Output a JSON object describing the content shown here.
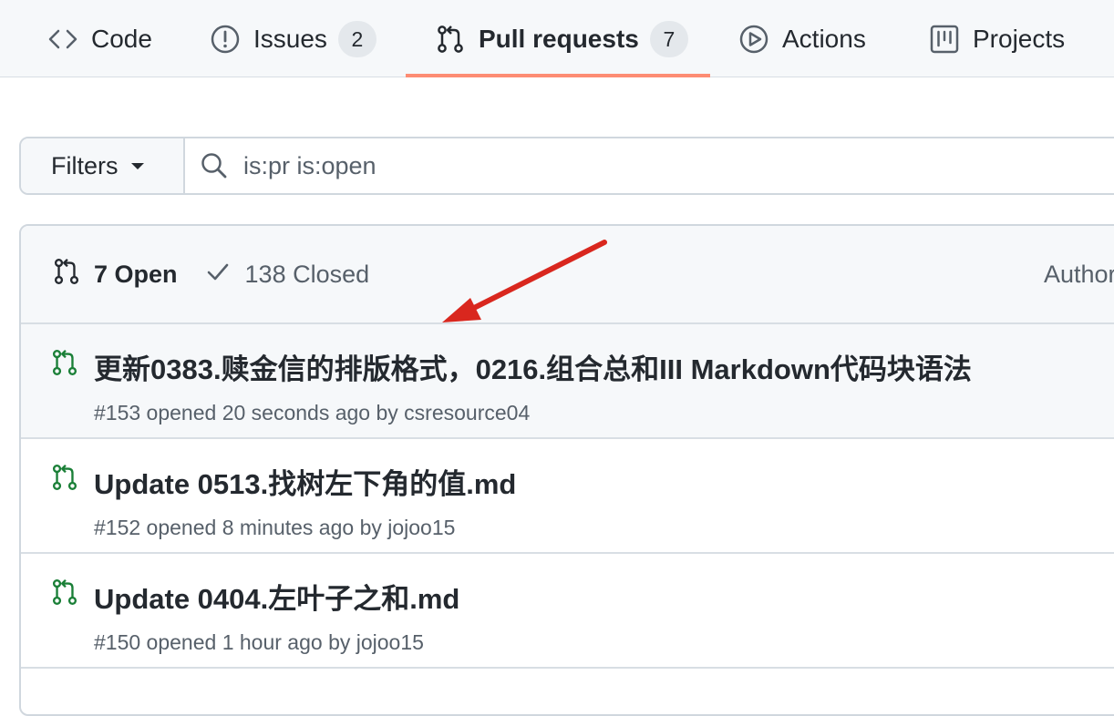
{
  "tabs": [
    {
      "label": "Code",
      "icon": "code-icon"
    },
    {
      "label": "Issues",
      "icon": "issue-opened-icon",
      "count": "2"
    },
    {
      "label": "Pull requests",
      "icon": "git-pull-request-icon",
      "count": "7",
      "selected": true
    },
    {
      "label": "Actions",
      "icon": "play-icon"
    },
    {
      "label": "Projects",
      "icon": "project-icon"
    }
  ],
  "filters": {
    "label": "Filters",
    "search_value": "is:pr is:open"
  },
  "list_header": {
    "open_label": "7 Open",
    "closed_label": "138 Closed",
    "author_label": "Author"
  },
  "pull_requests": [
    {
      "title": "更新0383.赎金信的排版格式，0216.组合总和III Markdown代码块语法",
      "meta": "#153 opened 20 seconds ago by ",
      "author": "csresource04"
    },
    {
      "title": "Update 0513.找树左下角的值.md",
      "meta": "#152 opened 8 minutes ago by ",
      "author": "jojoo15"
    },
    {
      "title": "Update 0404.左叶子之和.md",
      "meta": "#150 opened 1 hour ago by ",
      "author": "jojoo15"
    }
  ],
  "colors": {
    "accent_underline": "#fd8c73",
    "open_green": "#1a7f37",
    "annotation_red": "#d9271e"
  }
}
